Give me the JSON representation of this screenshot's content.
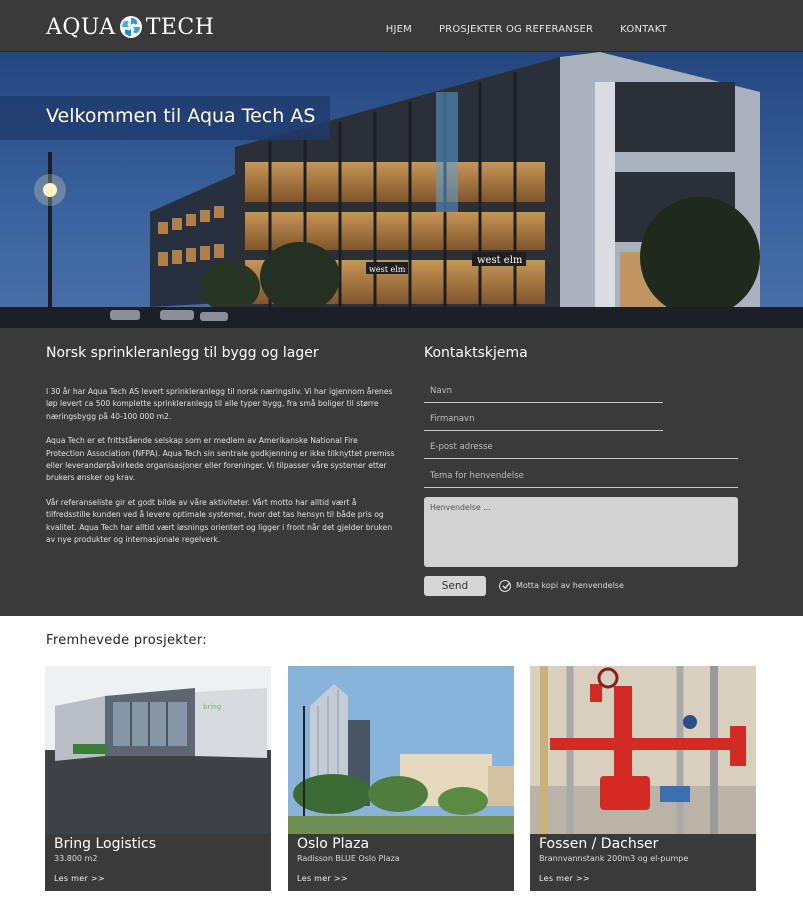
{
  "header": {
    "logo_left": "AQUA",
    "logo_right": "TECH",
    "nav": [
      {
        "label": "HJEM"
      },
      {
        "label": "PROSJEKTER OG REFERANSER"
      },
      {
        "label": "KONTAKT"
      }
    ]
  },
  "hero": {
    "title": "Velkommen til Aqua Tech AS",
    "signs": [
      "west elm",
      "west elm"
    ]
  },
  "intro": {
    "title": "Norsk sprinkleranlegg til bygg og lager",
    "paragraphs": [
      "I 30 år har Aqua Tech AS levert sprinkleranlegg til norsk næringsliv. Vi har igjennom årenes løp levert ca 500 komplette sprinkleranlegg til alle typer bygg, fra små boliger til større næringsbygg på 40-100 000 m2.",
      "Aqua Tech er et frittstående selskap som er medlem av Amerikanske National Fire Protection Association (NFPA). Aqua Tech sin sentrale godkjenning er ikke tilknyttet premiss eller leverandørpåvirkede organisasjoner eller foreninger. Vi tilpasser våre systemer etter brukers ønsker og krav.",
      "Vår referanseliste gir et godt bilde av våre aktiviteter. Vårt motto har alltid vært å tilfredsstille kunden ved å levere optimale systemer, hvor det tas hensyn til både pris og kvalitet. Aqua Tech har alltid vært løsnings orientert og ligger i front når det gjelder bruken av nye produkter og internasjonale regelverk."
    ]
  },
  "contact": {
    "title": "Kontaktskjema",
    "fields": {
      "name": "Navn",
      "company": "Firmanavn",
      "email": "E-post adresse",
      "topic": "Tema for henvendelse",
      "message": "Henvendelse ..."
    },
    "send_label": "Send",
    "copy_label": "Motta kopi av henvendelse",
    "copy_checked": true
  },
  "featured": {
    "title": "Fremhevede prosjekter:",
    "projects": [
      {
        "name": "Bring Logistics",
        "detail": "33.800 m2",
        "more": "Les mer >>",
        "sign": "bring"
      },
      {
        "name": "Oslo Plaza",
        "detail": "Radisson BLUE Oslo Plaza",
        "more": "Les mer >>"
      },
      {
        "name": "Fossen / Dachser",
        "detail": "Brannvannstank 200m3 og el-pumpe",
        "more": "Les mer >>"
      }
    ]
  },
  "colors": {
    "dark": "#3a3a3a",
    "accent_blue": "#2a7ec9",
    "white": "#ffffff"
  }
}
